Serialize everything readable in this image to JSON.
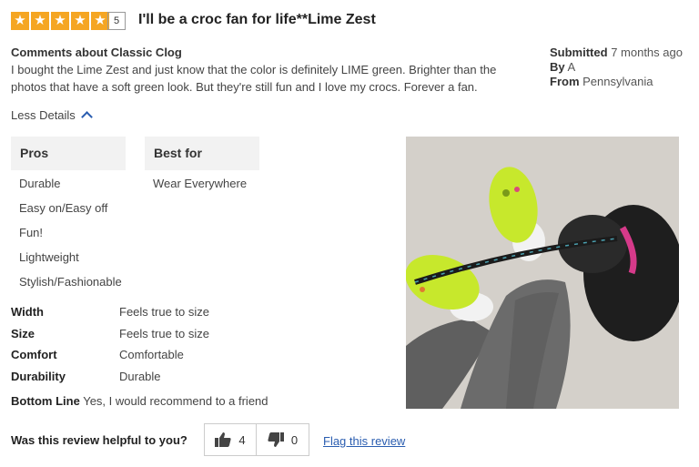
{
  "review": {
    "rating": "5",
    "title": "I'll be a croc fan for life**Lime Zest",
    "comments_heading": "Comments about Classic Clog",
    "comments_body": "I bought the Lime Zest and just know that the color is definitely LIME green. Brighter than the photos that have a soft green look. But they're still fun and I love my crocs. Forever a fan."
  },
  "meta": {
    "submitted_label": "Submitted",
    "submitted_value": "7 months ago",
    "by_label": "By",
    "by_value": "A",
    "from_label": "From",
    "from_value": "Pennsylvania"
  },
  "details_toggle": "Less Details",
  "pros": {
    "heading": "Pros",
    "items": [
      "Durable",
      "Easy on/Easy off",
      "Fun!",
      "Lightweight",
      "Stylish/Fashionable"
    ]
  },
  "best_for": {
    "heading": "Best for",
    "items": [
      "Wear Everywhere"
    ]
  },
  "attributes": [
    {
      "name": "Width",
      "value": "Feels true to size"
    },
    {
      "name": "Size",
      "value": "Feels true to size"
    },
    {
      "name": "Comfort",
      "value": "Comfortable"
    },
    {
      "name": "Durability",
      "value": "Durable"
    }
  ],
  "bottom_line": {
    "label": "Bottom Line",
    "value": "Yes, I would recommend to a friend"
  },
  "helpful": {
    "question": "Was this review helpful to you?",
    "up_count": "4",
    "down_count": "0",
    "flag_label": "Flag this review"
  },
  "colors": {
    "star": "#f5a623",
    "link": "#2a5db0",
    "header_bg": "#f2f2f2"
  },
  "icons": [
    "star-icon",
    "chevron-up-icon",
    "thumbs-up-icon",
    "thumbs-down-icon"
  ]
}
